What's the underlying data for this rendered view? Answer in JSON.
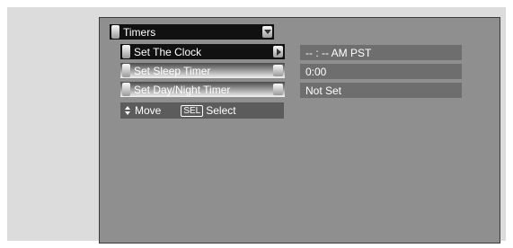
{
  "menu": {
    "title": "Timers",
    "items": [
      {
        "label": "Set The Clock",
        "value": "-- : --  AM PST",
        "selected": true
      },
      {
        "label": "Set Sleep Timer",
        "value": "0:00",
        "selected": false
      },
      {
        "label": "Set Day/Night Timer",
        "value": "Not Set",
        "selected": false
      }
    ]
  },
  "help": {
    "move_label": "Move",
    "sel_key": "SEL",
    "select_label": "Select"
  },
  "colors": {
    "screen_bg": "#8f8f8f",
    "selected_bg": "#111111",
    "value_bg": "#6e6e6e",
    "help_bg": "#5c5c5c"
  },
  "icons": {
    "header_tab": "tab-handle-icon",
    "dropdown": "dropdown-arrow-icon",
    "submenu": "right-arrow-icon",
    "move": "up-down-arrows-icon"
  }
}
